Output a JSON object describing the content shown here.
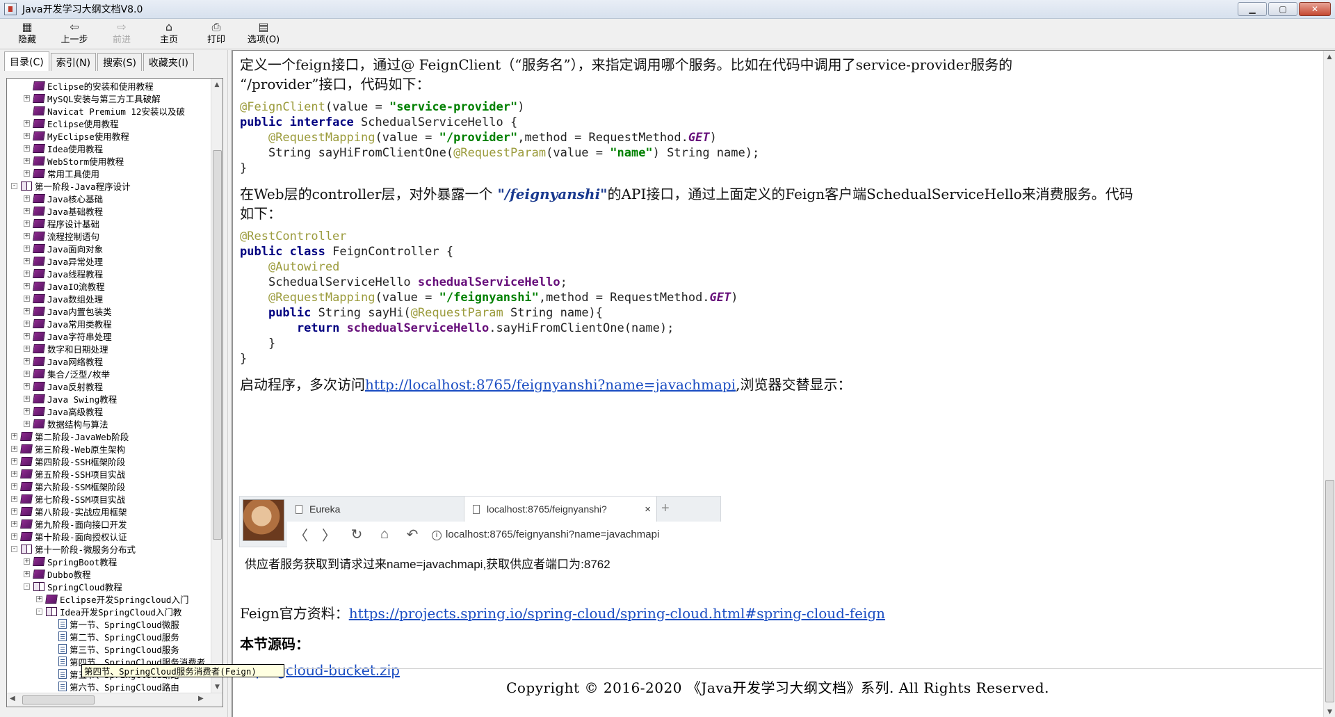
{
  "window": {
    "title": "Java开发学习大纲文档V8.0",
    "min_label": "▁",
    "max_label": "▢",
    "close_label": "✕"
  },
  "toolbar": [
    {
      "name": "hide",
      "label": "隐藏",
      "icon": "▦",
      "enabled": true
    },
    {
      "name": "back",
      "label": "上一步",
      "icon": "⇦",
      "enabled": true
    },
    {
      "name": "forward",
      "label": "前进",
      "icon": "⇨",
      "enabled": false
    },
    {
      "name": "home",
      "label": "主页",
      "icon": "⌂",
      "enabled": true
    },
    {
      "name": "print",
      "label": "打印",
      "icon": "⎙",
      "enabled": true
    },
    {
      "name": "options",
      "label": "选项(O)",
      "icon": "▤",
      "enabled": true
    }
  ],
  "tabs": [
    "目录(C)",
    "索引(N)",
    "搜索(S)",
    "收藏夹(I)"
  ],
  "tree": [
    {
      "indent": 2,
      "exp": "",
      "icon": "closed",
      "label": "Eclipse的安装和使用教程"
    },
    {
      "indent": 2,
      "exp": "+",
      "icon": "closed",
      "label": "MySQL安装与第三方工具破解"
    },
    {
      "indent": 2,
      "exp": "",
      "icon": "closed",
      "label": "Navicat Premium 12安装以及破"
    },
    {
      "indent": 2,
      "exp": "+",
      "icon": "closed",
      "label": "Eclipse使用教程"
    },
    {
      "indent": 2,
      "exp": "+",
      "icon": "closed",
      "label": "MyEclipse使用教程"
    },
    {
      "indent": 2,
      "exp": "+",
      "icon": "closed",
      "label": "Idea使用教程"
    },
    {
      "indent": 2,
      "exp": "+",
      "icon": "closed",
      "label": "WebStorm使用教程"
    },
    {
      "indent": 2,
      "exp": "+",
      "icon": "closed",
      "label": "常用工具使用"
    },
    {
      "indent": 1,
      "exp": "-",
      "icon": "open",
      "label": "第一阶段-Java程序设计"
    },
    {
      "indent": 2,
      "exp": "+",
      "icon": "closed",
      "label": "Java核心基础"
    },
    {
      "indent": 2,
      "exp": "+",
      "icon": "closed",
      "label": "Java基础教程"
    },
    {
      "indent": 2,
      "exp": "+",
      "icon": "closed",
      "label": "程序设计基础"
    },
    {
      "indent": 2,
      "exp": "+",
      "icon": "closed",
      "label": "流程控制语句"
    },
    {
      "indent": 2,
      "exp": "+",
      "icon": "closed",
      "label": "Java面向对象"
    },
    {
      "indent": 2,
      "exp": "+",
      "icon": "closed",
      "label": "Java异常处理"
    },
    {
      "indent": 2,
      "exp": "+",
      "icon": "closed",
      "label": "Java线程教程"
    },
    {
      "indent": 2,
      "exp": "+",
      "icon": "closed",
      "label": "JavaIO流教程"
    },
    {
      "indent": 2,
      "exp": "+",
      "icon": "closed",
      "label": "Java数组处理"
    },
    {
      "indent": 2,
      "exp": "+",
      "icon": "closed",
      "label": "Java内置包装类"
    },
    {
      "indent": 2,
      "exp": "+",
      "icon": "closed",
      "label": "Java常用类教程"
    },
    {
      "indent": 2,
      "exp": "+",
      "icon": "closed",
      "label": "Java字符串处理"
    },
    {
      "indent": 2,
      "exp": "+",
      "icon": "closed",
      "label": "数字和日期处理"
    },
    {
      "indent": 2,
      "exp": "+",
      "icon": "closed",
      "label": "Java网络教程"
    },
    {
      "indent": 2,
      "exp": "+",
      "icon": "closed",
      "label": "集合/泛型/枚举"
    },
    {
      "indent": 2,
      "exp": "+",
      "icon": "closed",
      "label": "Java反射教程"
    },
    {
      "indent": 2,
      "exp": "+",
      "icon": "closed",
      "label": "Java Swing教程"
    },
    {
      "indent": 2,
      "exp": "+",
      "icon": "closed",
      "label": "Java高级教程"
    },
    {
      "indent": 2,
      "exp": "+",
      "icon": "closed",
      "label": "数据结构与算法"
    },
    {
      "indent": 1,
      "exp": "+",
      "icon": "closed",
      "label": "第二阶段-JavaWeb阶段"
    },
    {
      "indent": 1,
      "exp": "+",
      "icon": "closed",
      "label": "第三阶段-Web原生架构"
    },
    {
      "indent": 1,
      "exp": "+",
      "icon": "closed",
      "label": "第四阶段-SSH框架阶段"
    },
    {
      "indent": 1,
      "exp": "+",
      "icon": "closed",
      "label": "第五阶段-SSH项目实战"
    },
    {
      "indent": 1,
      "exp": "+",
      "icon": "closed",
      "label": "第六阶段-SSM框架阶段"
    },
    {
      "indent": 1,
      "exp": "+",
      "icon": "closed",
      "label": "第七阶段-SSM项目实战"
    },
    {
      "indent": 1,
      "exp": "+",
      "icon": "closed",
      "label": "第八阶段-实战应用框架"
    },
    {
      "indent": 1,
      "exp": "+",
      "icon": "closed",
      "label": "第九阶段-面向接口开发"
    },
    {
      "indent": 1,
      "exp": "+",
      "icon": "closed",
      "label": "第十阶段-面向授权认证"
    },
    {
      "indent": 1,
      "exp": "-",
      "icon": "open",
      "label": "第十一阶段-微服务分布式"
    },
    {
      "indent": 2,
      "exp": "+",
      "icon": "closed",
      "label": "SpringBoot教程"
    },
    {
      "indent": 2,
      "exp": "+",
      "icon": "closed",
      "label": "Dubbo教程"
    },
    {
      "indent": 2,
      "exp": "-",
      "icon": "open",
      "label": "SpringCloud教程"
    },
    {
      "indent": 3,
      "exp": "+",
      "icon": "closed",
      "label": "Eclipse开发Springcloud入门"
    },
    {
      "indent": 3,
      "exp": "-",
      "icon": "open",
      "label": "Idea开发SpringCloud入门教"
    },
    {
      "indent": 4,
      "exp": "",
      "icon": "page",
      "label": "第一节、SpringCloud微服"
    },
    {
      "indent": 4,
      "exp": "",
      "icon": "page",
      "label": "第二节、SpringCloud服务"
    },
    {
      "indent": 4,
      "exp": "",
      "icon": "page",
      "label": "第三节、SpringCloud服务"
    },
    {
      "indent": 4,
      "exp": "",
      "icon": "page",
      "label": "第四节、SpringCloud服务消费者(Feign)"
    },
    {
      "indent": 4,
      "exp": "",
      "icon": "page",
      "label": "第五节、SpringCloud断路"
    },
    {
      "indent": 4,
      "exp": "",
      "icon": "page",
      "label": "第六节、SpringCloud路由"
    }
  ],
  "tooltip": "第四节、SpringCloud服务消费者(Feign)",
  "content": {
    "p1": "定义一个feign接口，通过@ FeignClient（“服务名”），来指定调用哪个服务。比如在代码中调用了service-provider服务的",
    "p1b": "“/provider”接口，代码如下：",
    "code1": {
      "anno_feign": "@FeignClient",
      "open_value": "(value = ",
      "str_service": "\"service-provider\"",
      "close_paren": ")",
      "kw_public": "public",
      "kw_interface": "interface",
      "class1": " SchedualServiceHello {",
      "anno_reqmap": "@RequestMapping",
      "str_provider": "\"/provider\"",
      "method_eq": ",method = RequestMethod.",
      "get": "GET",
      "sig": "String sayHiFromClientOne(",
      "anno_reqparam": "@RequestParam",
      "str_name": "\"name\"",
      "sig_end": ") String name);",
      "brace": "}"
    },
    "p2a": "在Web层的controller层，对外暴露一个",
    "p2hl": " \"/feignyanshi\"",
    "p2b": "的API接口，通过上面定义的Feign客户端SchedualServiceHello来消费服务。代码",
    "p2c": "如下：",
    "code2": {
      "anno_rest": "@RestController",
      "kw_class": "class",
      "class2": " FeignController {",
      "anno_autowired": "@Autowired",
      "field_type": "SchedualServiceHello ",
      "field_name": "schedualServiceHello",
      "semicolon": ";",
      "str_feignyanshi": "\"/feignyanshi\"",
      "method_sig": " String sayHi(",
      "param_end": " String name){",
      "kw_return": "return",
      "call": ".sayHiFromClientOne(name);",
      "inner_brace": "}"
    },
    "p3a": "启动程序，多次访问",
    "p3link": "http://localhost:8765/feignyanshi?name=javachmapi",
    "p3b": ",浏览器交替显示：",
    "shot": {
      "tab1": "Eureka",
      "tab2": "localhost:8765/feignyanshi?",
      "tab_close": "×",
      "plus": "+",
      "address_host": "localhost",
      "address_rest": ":8765/feignyanshi?name=javachmapi",
      "info": "i",
      "back": "〈",
      "forward": "〉",
      "reload": "↻",
      "home": "⌂",
      "undo": "↶",
      "body": "供应者服务获取到请求过来name=javachmapi,获取供应者端口为:8762"
    },
    "p4a": "Feign官方资料：",
    "p4link": "https://projects.spring.io/spring-cloud/spring-cloud.html#spring-cloud-feign",
    "section_title": "本节源码：",
    "zip": "spingcloud-bucket.zip",
    "copyright": "Copyright © 2016-2020 《Java开发学习大纲文档》系列. All Rights Reserved."
  },
  "scroll": {
    "up": "▲",
    "down": "▼",
    "left": "◀",
    "right": "▶"
  }
}
